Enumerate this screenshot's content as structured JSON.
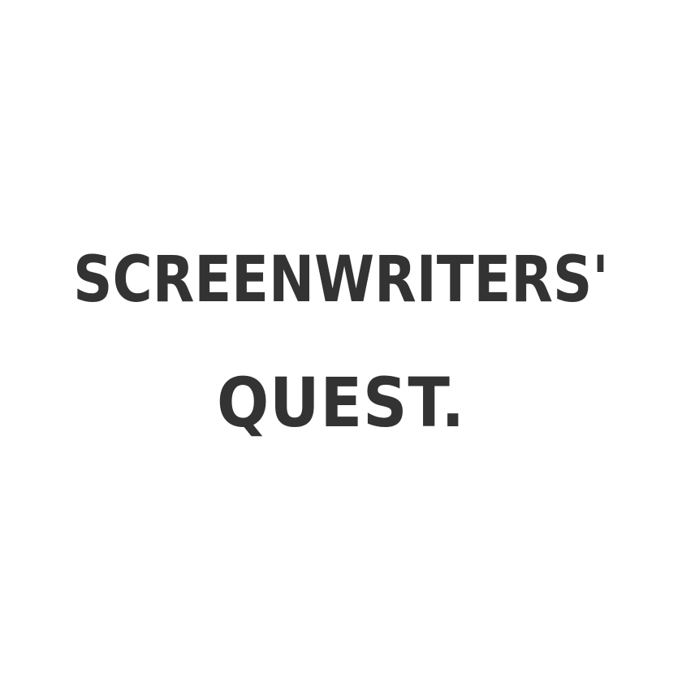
{
  "logo": {
    "line1": "SCREENWRITERS'",
    "line2": "QUEST."
  },
  "colors": {
    "background": "#ffffff",
    "text": "#333333"
  }
}
